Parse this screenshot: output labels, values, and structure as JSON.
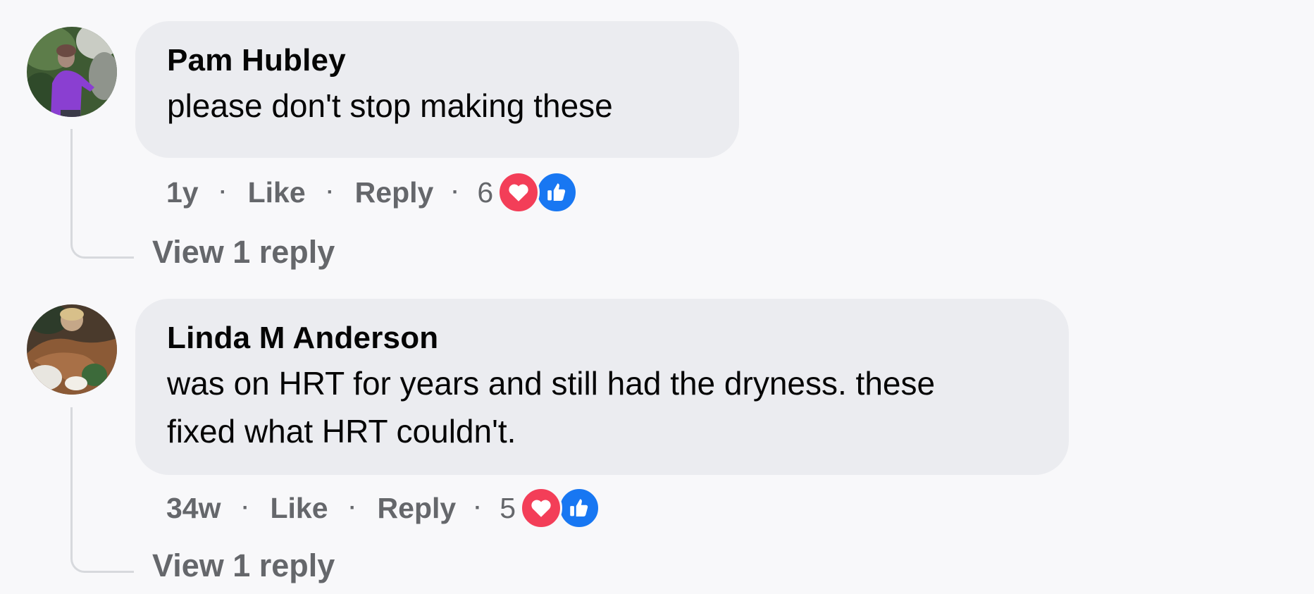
{
  "comments": [
    {
      "author": "Pam Hubley",
      "text": "please don't stop making these",
      "time": "1y",
      "like_label": "Like",
      "reply_label": "Reply",
      "reaction_count": "6",
      "reactions": [
        "love-icon",
        "like-icon"
      ],
      "view_replies_label": "View 1 reply"
    },
    {
      "author": "Linda M Anderson",
      "text_line1": "was on HRT for years and still had the dryness. these",
      "text_line2": "fixed what HRT couldn't.",
      "time": "34w",
      "like_label": "Like",
      "reply_label": "Reply",
      "reaction_count": "5",
      "reactions": [
        "love-icon",
        "like-icon"
      ],
      "view_replies_label": "View 1 reply"
    }
  ],
  "colors": {
    "background": "#f8f8fa",
    "bubble": "#ebecf0",
    "meta_text": "#65676b",
    "love": "#f33e58",
    "like": "#1877f2"
  },
  "separator": "·"
}
